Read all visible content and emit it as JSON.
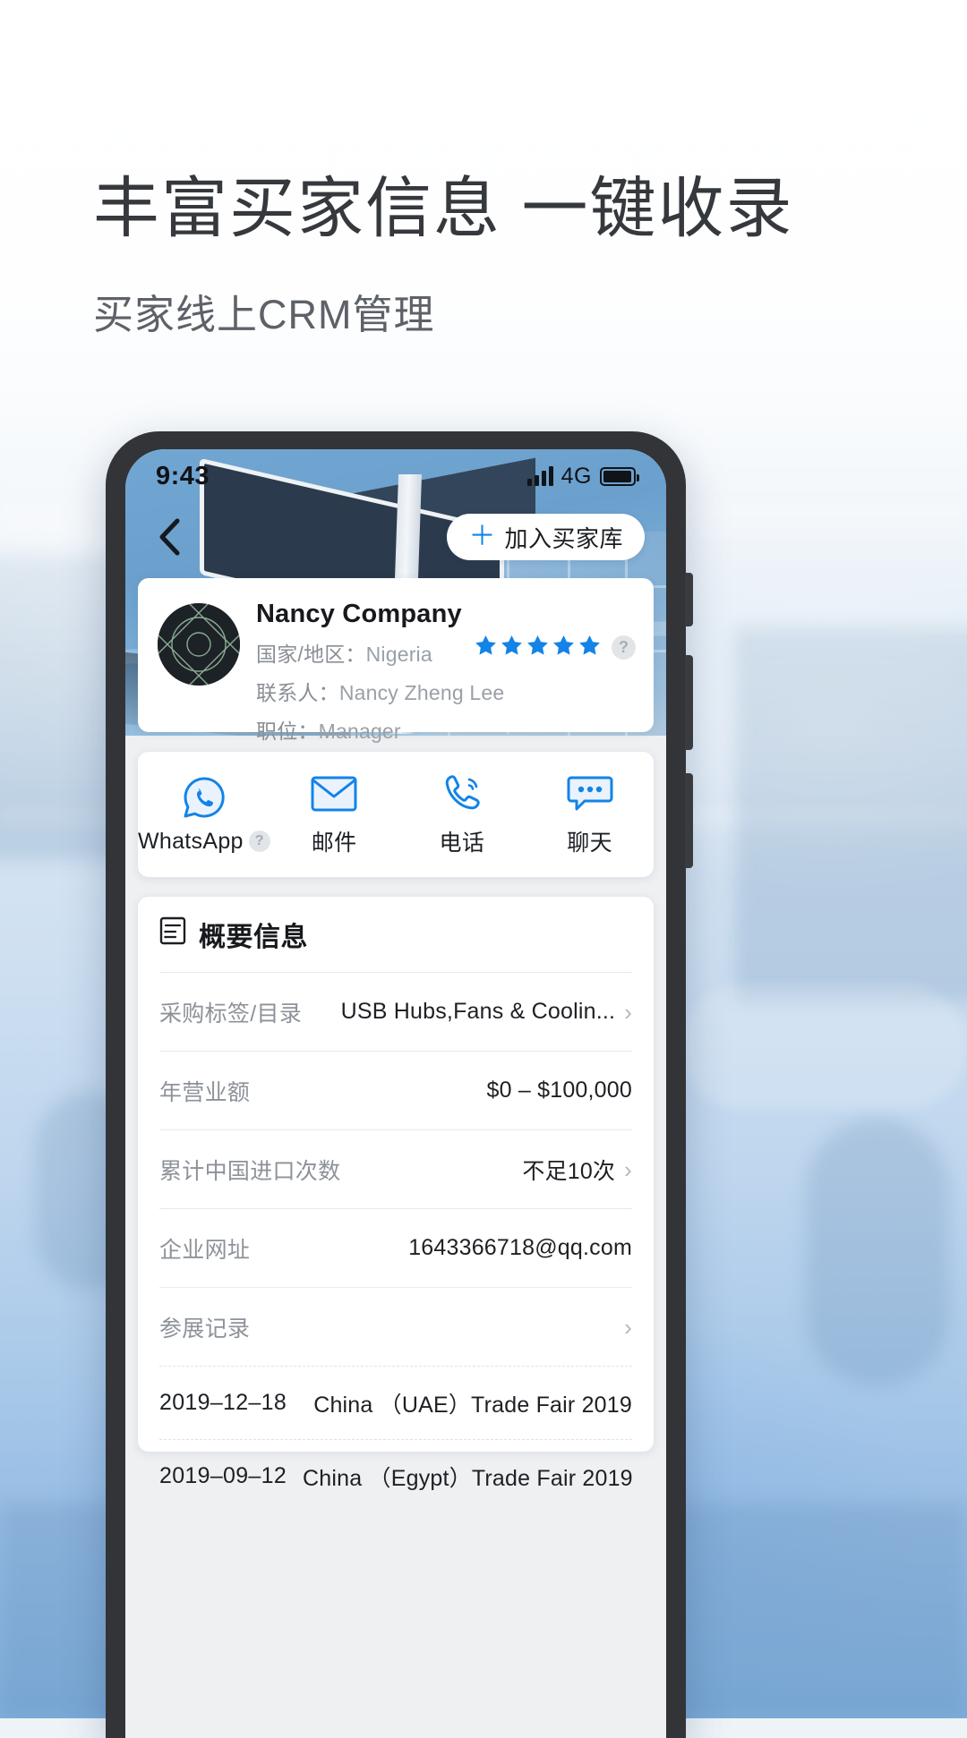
{
  "promo": {
    "headline": "丰富买家信息 一键收录",
    "subhead": "买家线上CRM管理"
  },
  "phone": {
    "status": {
      "time": "9:43",
      "network": "4G",
      "signal_icon": "signal-bars-icon",
      "battery_icon": "battery-full-icon"
    },
    "nav": {
      "back_icon": "chevron-left-icon",
      "add_plus": "＋",
      "add_label": "加入买家库"
    },
    "company": {
      "avatar_icon": "company-logo-avatar",
      "name": "Nancy Company",
      "country_label": "国家/地区：",
      "country_value": "Nigeria",
      "contact_label": "联系人：",
      "contact_value": "Nancy Zheng Lee",
      "title_label": "职位：",
      "title_value": "Manager",
      "rating": 5,
      "rating_help": "?",
      "star_color": "#1383e8"
    },
    "actions": [
      {
        "icon": "whatsapp-icon",
        "label": "WhatsApp",
        "help": "?"
      },
      {
        "icon": "mail-icon",
        "label": "邮件",
        "help": ""
      },
      {
        "icon": "phone-call-icon",
        "label": "电话",
        "help": ""
      },
      {
        "icon": "chat-bubble-icon",
        "label": "聊天",
        "help": ""
      }
    ],
    "summary": {
      "icon": "summary-list-icon",
      "title": "概要信息",
      "rows": [
        {
          "key": "采购标签/目录",
          "value": "USB Hubs,Fans & Coolin...",
          "chevron": "›"
        },
        {
          "key": "年营业额",
          "value": "$0 – $100,000",
          "chevron": ""
        },
        {
          "key": "累计中国进口次数",
          "value": "不足10次",
          "chevron": "›"
        },
        {
          "key": "企业网址",
          "value": "1643366718@qq.com",
          "chevron": ""
        },
        {
          "key": "参展记录",
          "value": "",
          "chevron": "›"
        }
      ],
      "fairs": [
        {
          "date": "2019–12–18",
          "name": "China （UAE）Trade Fair 2019"
        },
        {
          "date": "2019–09–12",
          "name": "China （Egypt）Trade Fair 2019"
        }
      ]
    }
  },
  "theme": {
    "accent": "#1383e8",
    "text_dark": "#1d2024",
    "text_muted": "#8d9299"
  }
}
